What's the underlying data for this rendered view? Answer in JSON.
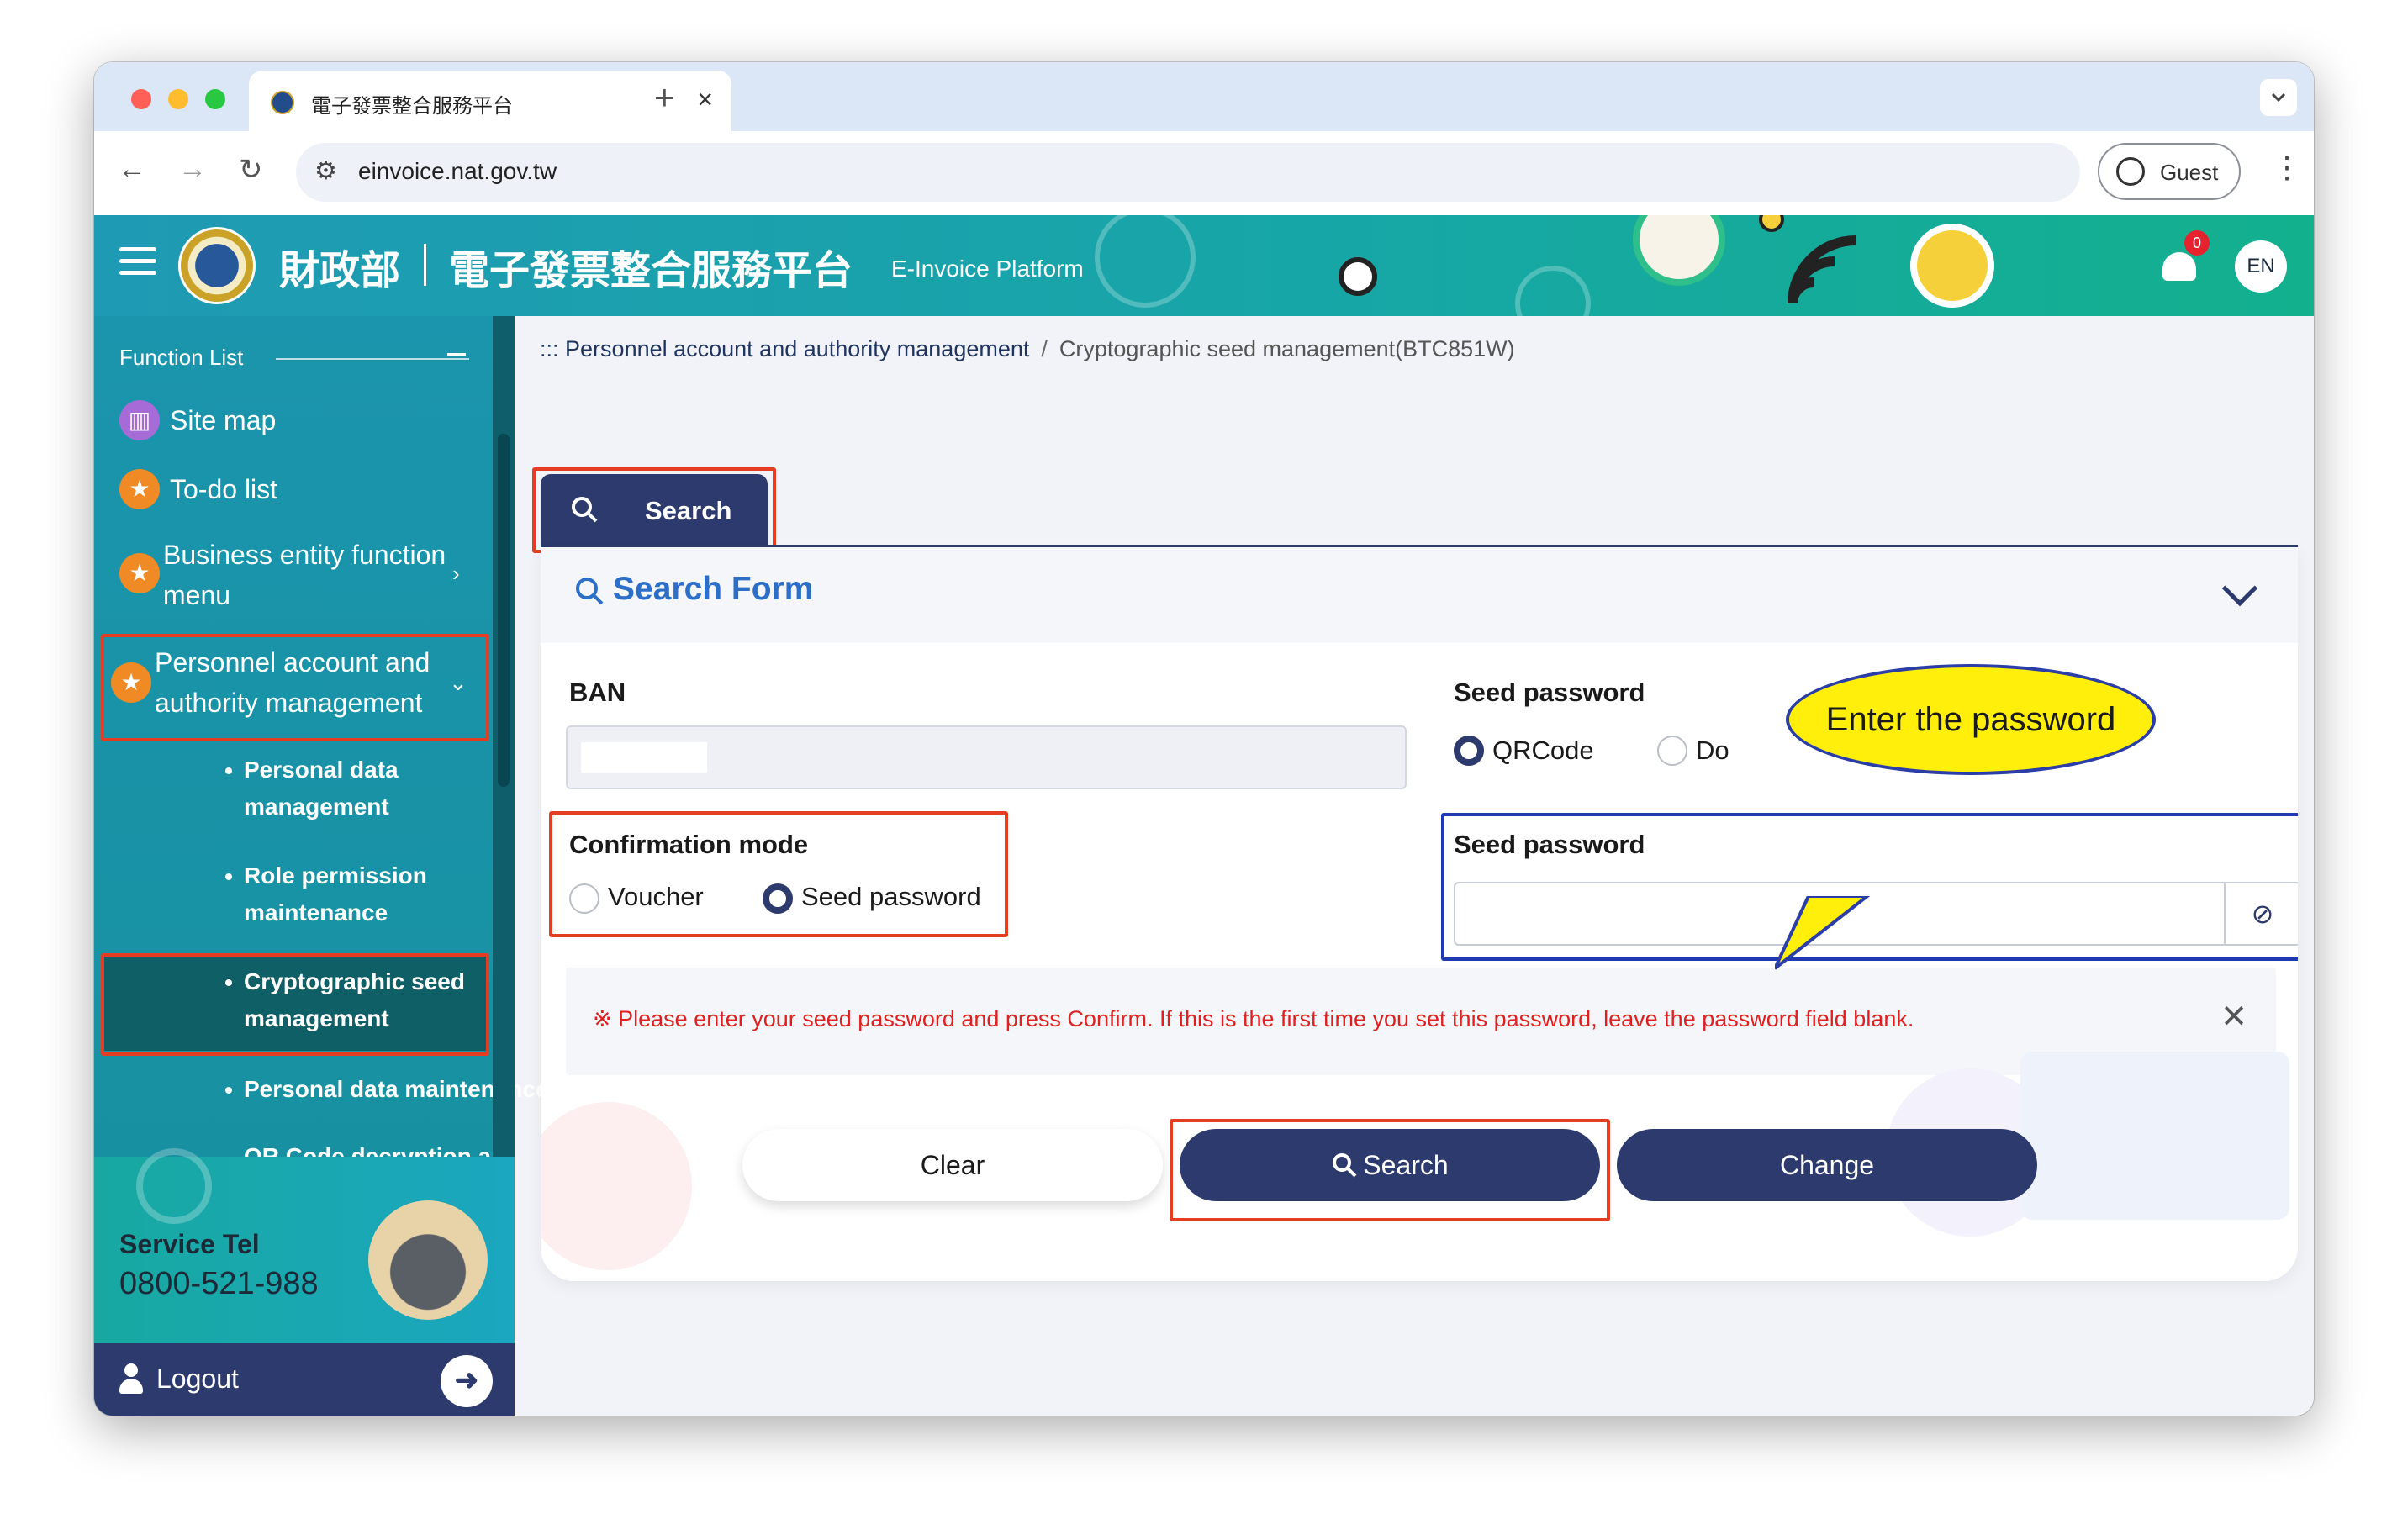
{
  "browser": {
    "tab_title": "電子發票整合服務平台",
    "url": "einvoice.nat.gov.tw",
    "profile": "Guest",
    "new_tab": "+",
    "close_tab": "×"
  },
  "header": {
    "ministry": "財政部",
    "platform": "電子發票整合服務平台",
    "platform_en": "E-Invoice Platform",
    "notification_count": "0",
    "language": "EN"
  },
  "sidebar": {
    "function_list": "Function List",
    "items": [
      {
        "label": "Site map",
        "icon": "map-icon"
      },
      {
        "label": "To-do list",
        "icon": "star-icon"
      },
      {
        "label": "Business entity function menu",
        "icon": "star-icon"
      },
      {
        "label": "Personnel account and authority management",
        "icon": "star-icon"
      }
    ],
    "subitems": [
      "Personal data management",
      "Role permission maintenance",
      "Cryptographic seed management",
      "Personal data maintenance",
      "QR Code decryption and"
    ],
    "service_tel_label": "Service Tel",
    "service_tel": "0800-521-988",
    "logout": "Logout"
  },
  "breadcrumb": {
    "prefix": ":::",
    "parent": "Personnel account and authority management",
    "separator": "/",
    "current": "Cryptographic seed management(BTC851W)"
  },
  "main": {
    "tab_label": "Search",
    "form_title": "Search Form",
    "ban_label": "BAN",
    "seed_password_label": "Seed password",
    "seed_options": [
      "QRCode",
      "Do"
    ],
    "confirm_mode_label": "Confirmation mode",
    "confirm_options": [
      "Voucher",
      "Seed password"
    ],
    "seed_password_input_label": "Seed password",
    "notice": "※ Please enter your seed password and press Confirm. If this is the first time you set this password, leave the password field blank.",
    "buttons": {
      "clear": "Clear",
      "search": "Search",
      "change": "Change"
    }
  },
  "callout": "Enter the password",
  "colors": {
    "navy": "#2d3a6e",
    "teal": "#1a9db0",
    "highlight_red": "#e53d22",
    "highlight_blue": "#1f3ab0",
    "callout_yellow": "#ffef0a"
  }
}
